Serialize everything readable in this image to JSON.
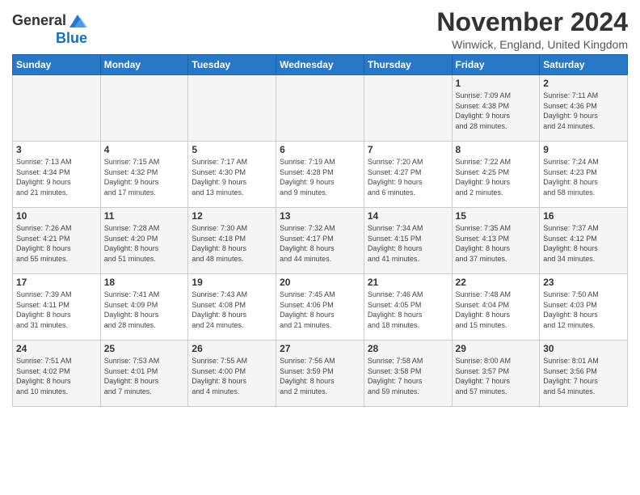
{
  "logo": {
    "general": "General",
    "blue": "Blue"
  },
  "header": {
    "month": "November 2024",
    "location": "Winwick, England, United Kingdom"
  },
  "weekdays": [
    "Sunday",
    "Monday",
    "Tuesday",
    "Wednesday",
    "Thursday",
    "Friday",
    "Saturday"
  ],
  "weeks": [
    [
      {
        "day": "",
        "info": ""
      },
      {
        "day": "",
        "info": ""
      },
      {
        "day": "",
        "info": ""
      },
      {
        "day": "",
        "info": ""
      },
      {
        "day": "",
        "info": ""
      },
      {
        "day": "1",
        "info": "Sunrise: 7:09 AM\nSunset: 4:38 PM\nDaylight: 9 hours\nand 28 minutes."
      },
      {
        "day": "2",
        "info": "Sunrise: 7:11 AM\nSunset: 4:36 PM\nDaylight: 9 hours\nand 24 minutes."
      }
    ],
    [
      {
        "day": "3",
        "info": "Sunrise: 7:13 AM\nSunset: 4:34 PM\nDaylight: 9 hours\nand 21 minutes."
      },
      {
        "day": "4",
        "info": "Sunrise: 7:15 AM\nSunset: 4:32 PM\nDaylight: 9 hours\nand 17 minutes."
      },
      {
        "day": "5",
        "info": "Sunrise: 7:17 AM\nSunset: 4:30 PM\nDaylight: 9 hours\nand 13 minutes."
      },
      {
        "day": "6",
        "info": "Sunrise: 7:19 AM\nSunset: 4:28 PM\nDaylight: 9 hours\nand 9 minutes."
      },
      {
        "day": "7",
        "info": "Sunrise: 7:20 AM\nSunset: 4:27 PM\nDaylight: 9 hours\nand 6 minutes."
      },
      {
        "day": "8",
        "info": "Sunrise: 7:22 AM\nSunset: 4:25 PM\nDaylight: 9 hours\nand 2 minutes."
      },
      {
        "day": "9",
        "info": "Sunrise: 7:24 AM\nSunset: 4:23 PM\nDaylight: 8 hours\nand 58 minutes."
      }
    ],
    [
      {
        "day": "10",
        "info": "Sunrise: 7:26 AM\nSunset: 4:21 PM\nDaylight: 8 hours\nand 55 minutes."
      },
      {
        "day": "11",
        "info": "Sunrise: 7:28 AM\nSunset: 4:20 PM\nDaylight: 8 hours\nand 51 minutes."
      },
      {
        "day": "12",
        "info": "Sunrise: 7:30 AM\nSunset: 4:18 PM\nDaylight: 8 hours\nand 48 minutes."
      },
      {
        "day": "13",
        "info": "Sunrise: 7:32 AM\nSunset: 4:17 PM\nDaylight: 8 hours\nand 44 minutes."
      },
      {
        "day": "14",
        "info": "Sunrise: 7:34 AM\nSunset: 4:15 PM\nDaylight: 8 hours\nand 41 minutes."
      },
      {
        "day": "15",
        "info": "Sunrise: 7:35 AM\nSunset: 4:13 PM\nDaylight: 8 hours\nand 37 minutes."
      },
      {
        "day": "16",
        "info": "Sunrise: 7:37 AM\nSunset: 4:12 PM\nDaylight: 8 hours\nand 34 minutes."
      }
    ],
    [
      {
        "day": "17",
        "info": "Sunrise: 7:39 AM\nSunset: 4:11 PM\nDaylight: 8 hours\nand 31 minutes."
      },
      {
        "day": "18",
        "info": "Sunrise: 7:41 AM\nSunset: 4:09 PM\nDaylight: 8 hours\nand 28 minutes."
      },
      {
        "day": "19",
        "info": "Sunrise: 7:43 AM\nSunset: 4:08 PM\nDaylight: 8 hours\nand 24 minutes."
      },
      {
        "day": "20",
        "info": "Sunrise: 7:45 AM\nSunset: 4:06 PM\nDaylight: 8 hours\nand 21 minutes."
      },
      {
        "day": "21",
        "info": "Sunrise: 7:46 AM\nSunset: 4:05 PM\nDaylight: 8 hours\nand 18 minutes."
      },
      {
        "day": "22",
        "info": "Sunrise: 7:48 AM\nSunset: 4:04 PM\nDaylight: 8 hours\nand 15 minutes."
      },
      {
        "day": "23",
        "info": "Sunrise: 7:50 AM\nSunset: 4:03 PM\nDaylight: 8 hours\nand 12 minutes."
      }
    ],
    [
      {
        "day": "24",
        "info": "Sunrise: 7:51 AM\nSunset: 4:02 PM\nDaylight: 8 hours\nand 10 minutes."
      },
      {
        "day": "25",
        "info": "Sunrise: 7:53 AM\nSunset: 4:01 PM\nDaylight: 8 hours\nand 7 minutes."
      },
      {
        "day": "26",
        "info": "Sunrise: 7:55 AM\nSunset: 4:00 PM\nDaylight: 8 hours\nand 4 minutes."
      },
      {
        "day": "27",
        "info": "Sunrise: 7:56 AM\nSunset: 3:59 PM\nDaylight: 8 hours\nand 2 minutes."
      },
      {
        "day": "28",
        "info": "Sunrise: 7:58 AM\nSunset: 3:58 PM\nDaylight: 7 hours\nand 59 minutes."
      },
      {
        "day": "29",
        "info": "Sunrise: 8:00 AM\nSunset: 3:57 PM\nDaylight: 7 hours\nand 57 minutes."
      },
      {
        "day": "30",
        "info": "Sunrise: 8:01 AM\nSunset: 3:56 PM\nDaylight: 7 hours\nand 54 minutes."
      }
    ]
  ]
}
